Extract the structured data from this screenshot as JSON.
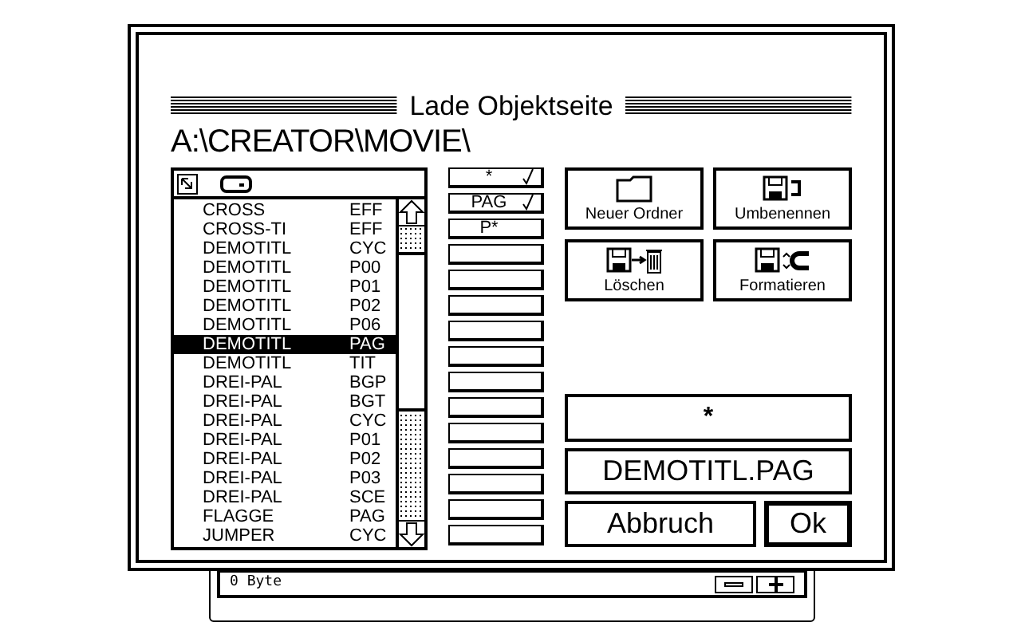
{
  "dialog": {
    "title": "Lade Objektseite",
    "path": "A:\\CREATOR\\MOVIE\\"
  },
  "files": [
    {
      "name": "CROSS",
      "ext": "EFF",
      "selected": false
    },
    {
      "name": "CROSS-TI",
      "ext": "EFF",
      "selected": false
    },
    {
      "name": "DEMOTITL",
      "ext": "CYC",
      "selected": false
    },
    {
      "name": "DEMOTITL",
      "ext": "P00",
      "selected": false
    },
    {
      "name": "DEMOTITL",
      "ext": "P01",
      "selected": false
    },
    {
      "name": "DEMOTITL",
      "ext": "P02",
      "selected": false
    },
    {
      "name": "DEMOTITL",
      "ext": "P06",
      "selected": false
    },
    {
      "name": "DEMOTITL",
      "ext": "PAG",
      "selected": true
    },
    {
      "name": "DEMOTITL",
      "ext": "TIT",
      "selected": false
    },
    {
      "name": "DREI-PAL",
      "ext": "BGP",
      "selected": false
    },
    {
      "name": "DREI-PAL",
      "ext": "BGT",
      "selected": false
    },
    {
      "name": "DREI-PAL",
      "ext": "CYC",
      "selected": false
    },
    {
      "name": "DREI-PAL",
      "ext": "P01",
      "selected": false
    },
    {
      "name": "DREI-PAL",
      "ext": "P02",
      "selected": false
    },
    {
      "name": "DREI-PAL",
      "ext": "P03",
      "selected": false
    },
    {
      "name": "DREI-PAL",
      "ext": "SCE",
      "selected": false
    },
    {
      "name": "FLAGGE",
      "ext": "PAG",
      "selected": false
    },
    {
      "name": "JUMPER",
      "ext": "CYC",
      "selected": false
    }
  ],
  "filters": [
    {
      "kind": "label",
      "label": "*",
      "checked": true
    },
    {
      "kind": "label",
      "label": "PAG",
      "checked": true
    },
    {
      "kind": "label",
      "label": "P*",
      "checked": false
    },
    {
      "kind": "empty"
    },
    {
      "kind": "empty"
    },
    {
      "kind": "empty"
    },
    {
      "kind": "empty"
    },
    {
      "kind": "empty"
    },
    {
      "kind": "empty"
    },
    {
      "kind": "empty"
    },
    {
      "kind": "empty"
    },
    {
      "kind": "empty"
    },
    {
      "kind": "empty"
    },
    {
      "kind": "empty"
    },
    {
      "kind": "empty"
    }
  ],
  "actions": [
    {
      "kind": "folder",
      "label": "Neuer Ordner"
    },
    {
      "kind": "rename",
      "label": "Umbenennen"
    },
    {
      "kind": "delete",
      "label": "Löschen"
    },
    {
      "kind": "format",
      "label": "Formatieren"
    }
  ],
  "filter_field": {
    "value": "*"
  },
  "filename_field": {
    "value": "DEMOTITL.PAG"
  },
  "buttons": [
    {
      "label": "Abbruch",
      "default": false
    },
    {
      "label": "Ok",
      "default": true
    }
  ],
  "status_bar": {
    "text": "0 Byte"
  }
}
